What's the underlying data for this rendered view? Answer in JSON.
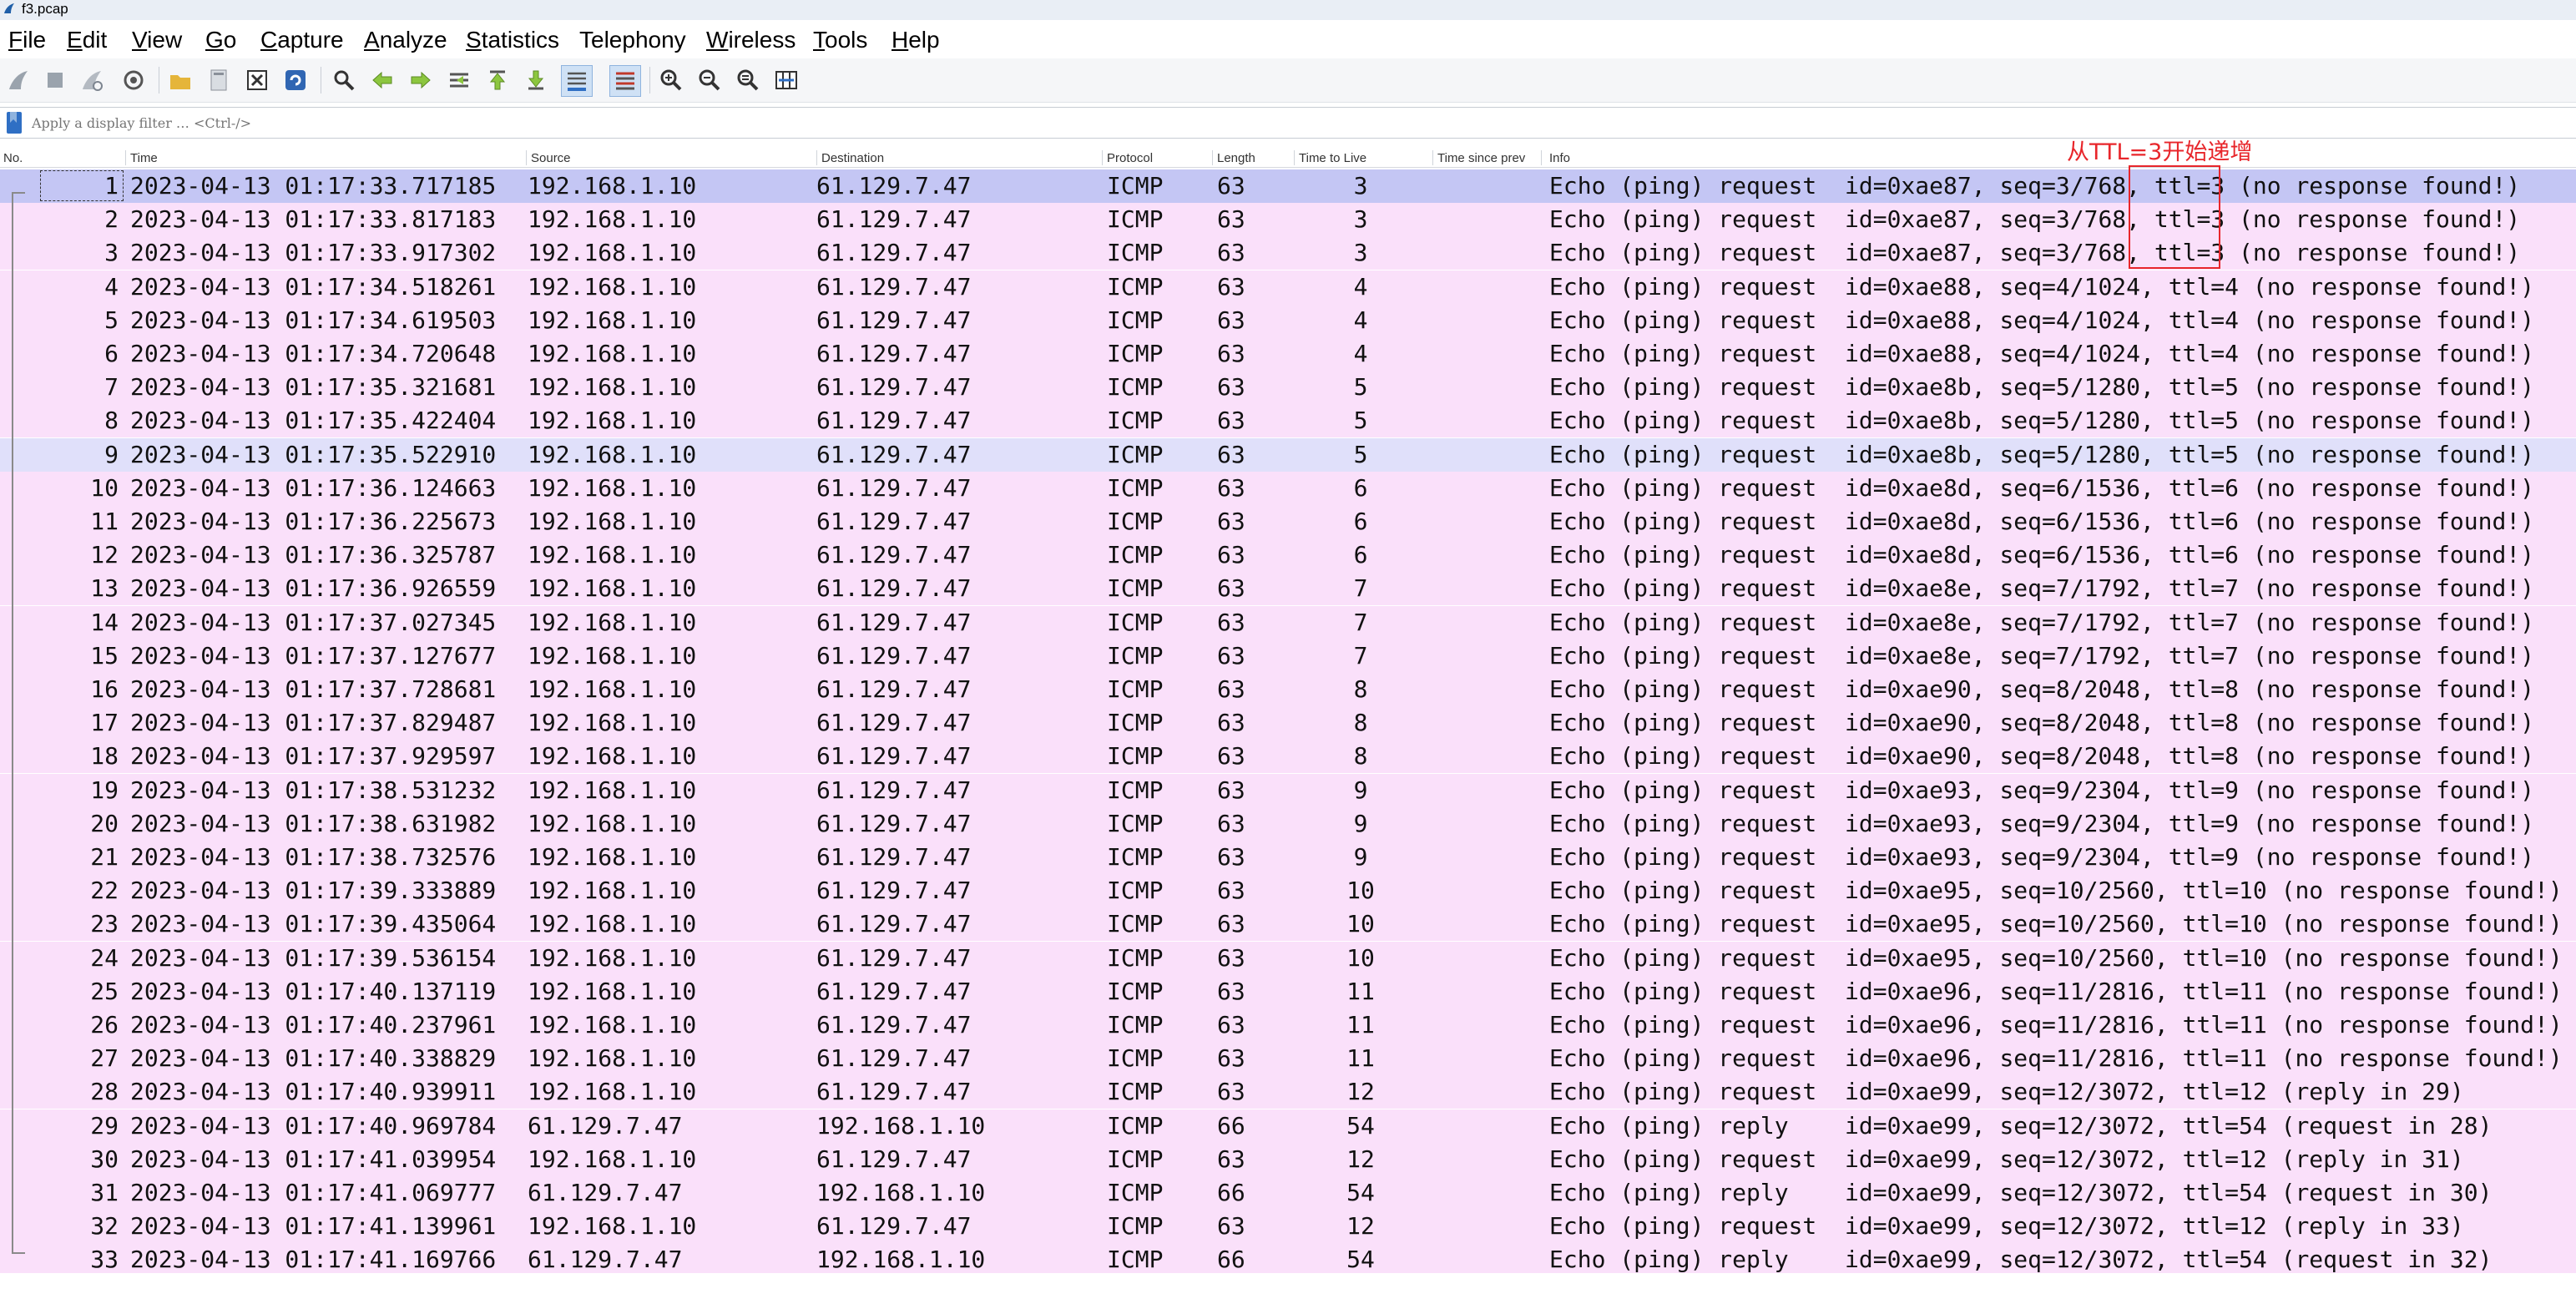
{
  "window": {
    "title": "f3.pcap"
  },
  "menu": [
    {
      "label": "File",
      "ul": "F",
      "rest": "ile"
    },
    {
      "label": "Edit",
      "ul": "E",
      "rest": "dit"
    },
    {
      "label": "View",
      "ul": "V",
      "rest": "iew"
    },
    {
      "label": "Go",
      "ul": "G",
      "rest": "o"
    },
    {
      "label": "Capture",
      "ul": "C",
      "rest": "apture"
    },
    {
      "label": "Analyze",
      "ul": "A",
      "rest": "nalyze"
    },
    {
      "label": "Statistics",
      "ul": "S",
      "rest": "tatistics"
    },
    {
      "label": "Telephony",
      "ul": "",
      "rest": "Telephony"
    },
    {
      "label": "Wireless",
      "ul": "W",
      "rest": "ireless"
    },
    {
      "label": "Tools",
      "ul": "T",
      "rest": "ools"
    },
    {
      "label": "Help",
      "ul": "H",
      "rest": "elp"
    }
  ],
  "filter": {
    "placeholder": "Apply a display filter … <Ctrl-/>"
  },
  "columns": {
    "no": "No.",
    "time": "Time",
    "source": "Source",
    "destination": "Destination",
    "protocol": "Protocol",
    "length": "Length",
    "ttl": "Time to Live",
    "since": "Time since prev",
    "info": "Info"
  },
  "annotation": {
    "text": "从TTL=3开始递增"
  },
  "colors": {
    "row": "#fae0fa",
    "selected": "#c4c6f4",
    "highlight": "#e0e0fa",
    "annotation": "#e8262b"
  },
  "rows": [
    {
      "no": "1",
      "time": "2023-04-13 01:17:33.717185",
      "src": "192.168.1.10",
      "dst": "61.129.7.47",
      "proto": "ICMP",
      "len": "63",
      "ttl": "3",
      "info": "Echo (ping) request  id=0xae87, seq=3/768, ttl=3 (no response found!)"
    },
    {
      "no": "2",
      "time": "2023-04-13 01:17:33.817183",
      "src": "192.168.1.10",
      "dst": "61.129.7.47",
      "proto": "ICMP",
      "len": "63",
      "ttl": "3",
      "info": "Echo (ping) request  id=0xae87, seq=3/768, ttl=3 (no response found!)"
    },
    {
      "no": "3",
      "time": "2023-04-13 01:17:33.917302",
      "src": "192.168.1.10",
      "dst": "61.129.7.47",
      "proto": "ICMP",
      "len": "63",
      "ttl": "3",
      "info": "Echo (ping) request  id=0xae87, seq=3/768, ttl=3 (no response found!)"
    },
    {
      "no": "4",
      "time": "2023-04-13 01:17:34.518261",
      "src": "192.168.1.10",
      "dst": "61.129.7.47",
      "proto": "ICMP",
      "len": "63",
      "ttl": "4",
      "info": "Echo (ping) request  id=0xae88, seq=4/1024, ttl=4 (no response found!)"
    },
    {
      "no": "5",
      "time": "2023-04-13 01:17:34.619503",
      "src": "192.168.1.10",
      "dst": "61.129.7.47",
      "proto": "ICMP",
      "len": "63",
      "ttl": "4",
      "info": "Echo (ping) request  id=0xae88, seq=4/1024, ttl=4 (no response found!)"
    },
    {
      "no": "6",
      "time": "2023-04-13 01:17:34.720648",
      "src": "192.168.1.10",
      "dst": "61.129.7.47",
      "proto": "ICMP",
      "len": "63",
      "ttl": "4",
      "info": "Echo (ping) request  id=0xae88, seq=4/1024, ttl=4 (no response found!)"
    },
    {
      "no": "7",
      "time": "2023-04-13 01:17:35.321681",
      "src": "192.168.1.10",
      "dst": "61.129.7.47",
      "proto": "ICMP",
      "len": "63",
      "ttl": "5",
      "info": "Echo (ping) request  id=0xae8b, seq=5/1280, ttl=5 (no response found!)"
    },
    {
      "no": "8",
      "time": "2023-04-13 01:17:35.422404",
      "src": "192.168.1.10",
      "dst": "61.129.7.47",
      "proto": "ICMP",
      "len": "63",
      "ttl": "5",
      "info": "Echo (ping) request  id=0xae8b, seq=5/1280, ttl=5 (no response found!)"
    },
    {
      "no": "9",
      "time": "2023-04-13 01:17:35.522910",
      "src": "192.168.1.10",
      "dst": "61.129.7.47",
      "proto": "ICMP",
      "len": "63",
      "ttl": "5",
      "info": "Echo (ping) request  id=0xae8b, seq=5/1280, ttl=5 (no response found!)"
    },
    {
      "no": "10",
      "time": "2023-04-13 01:17:36.124663",
      "src": "192.168.1.10",
      "dst": "61.129.7.47",
      "proto": "ICMP",
      "len": "63",
      "ttl": "6",
      "info": "Echo (ping) request  id=0xae8d, seq=6/1536, ttl=6 (no response found!)"
    },
    {
      "no": "11",
      "time": "2023-04-13 01:17:36.225673",
      "src": "192.168.1.10",
      "dst": "61.129.7.47",
      "proto": "ICMP",
      "len": "63",
      "ttl": "6",
      "info": "Echo (ping) request  id=0xae8d, seq=6/1536, ttl=6 (no response found!)"
    },
    {
      "no": "12",
      "time": "2023-04-13 01:17:36.325787",
      "src": "192.168.1.10",
      "dst": "61.129.7.47",
      "proto": "ICMP",
      "len": "63",
      "ttl": "6",
      "info": "Echo (ping) request  id=0xae8d, seq=6/1536, ttl=6 (no response found!)"
    },
    {
      "no": "13",
      "time": "2023-04-13 01:17:36.926559",
      "src": "192.168.1.10",
      "dst": "61.129.7.47",
      "proto": "ICMP",
      "len": "63",
      "ttl": "7",
      "info": "Echo (ping) request  id=0xae8e, seq=7/1792, ttl=7 (no response found!)"
    },
    {
      "no": "14",
      "time": "2023-04-13 01:17:37.027345",
      "src": "192.168.1.10",
      "dst": "61.129.7.47",
      "proto": "ICMP",
      "len": "63",
      "ttl": "7",
      "info": "Echo (ping) request  id=0xae8e, seq=7/1792, ttl=7 (no response found!)"
    },
    {
      "no": "15",
      "time": "2023-04-13 01:17:37.127677",
      "src": "192.168.1.10",
      "dst": "61.129.7.47",
      "proto": "ICMP",
      "len": "63",
      "ttl": "7",
      "info": "Echo (ping) request  id=0xae8e, seq=7/1792, ttl=7 (no response found!)"
    },
    {
      "no": "16",
      "time": "2023-04-13 01:17:37.728681",
      "src": "192.168.1.10",
      "dst": "61.129.7.47",
      "proto": "ICMP",
      "len": "63",
      "ttl": "8",
      "info": "Echo (ping) request  id=0xae90, seq=8/2048, ttl=8 (no response found!)"
    },
    {
      "no": "17",
      "time": "2023-04-13 01:17:37.829487",
      "src": "192.168.1.10",
      "dst": "61.129.7.47",
      "proto": "ICMP",
      "len": "63",
      "ttl": "8",
      "info": "Echo (ping) request  id=0xae90, seq=8/2048, ttl=8 (no response found!)"
    },
    {
      "no": "18",
      "time": "2023-04-13 01:17:37.929597",
      "src": "192.168.1.10",
      "dst": "61.129.7.47",
      "proto": "ICMP",
      "len": "63",
      "ttl": "8",
      "info": "Echo (ping) request  id=0xae90, seq=8/2048, ttl=8 (no response found!)"
    },
    {
      "no": "19",
      "time": "2023-04-13 01:17:38.531232",
      "src": "192.168.1.10",
      "dst": "61.129.7.47",
      "proto": "ICMP",
      "len": "63",
      "ttl": "9",
      "info": "Echo (ping) request  id=0xae93, seq=9/2304, ttl=9 (no response found!)"
    },
    {
      "no": "20",
      "time": "2023-04-13 01:17:38.631982",
      "src": "192.168.1.10",
      "dst": "61.129.7.47",
      "proto": "ICMP",
      "len": "63",
      "ttl": "9",
      "info": "Echo (ping) request  id=0xae93, seq=9/2304, ttl=9 (no response found!)"
    },
    {
      "no": "21",
      "time": "2023-04-13 01:17:38.732576",
      "src": "192.168.1.10",
      "dst": "61.129.7.47",
      "proto": "ICMP",
      "len": "63",
      "ttl": "9",
      "info": "Echo (ping) request  id=0xae93, seq=9/2304, ttl=9 (no response found!)"
    },
    {
      "no": "22",
      "time": "2023-04-13 01:17:39.333889",
      "src": "192.168.1.10",
      "dst": "61.129.7.47",
      "proto": "ICMP",
      "len": "63",
      "ttl": "10",
      "info": "Echo (ping) request  id=0xae95, seq=10/2560, ttl=10 (no response found!)"
    },
    {
      "no": "23",
      "time": "2023-04-13 01:17:39.435064",
      "src": "192.168.1.10",
      "dst": "61.129.7.47",
      "proto": "ICMP",
      "len": "63",
      "ttl": "10",
      "info": "Echo (ping) request  id=0xae95, seq=10/2560, ttl=10 (no response found!)"
    },
    {
      "no": "24",
      "time": "2023-04-13 01:17:39.536154",
      "src": "192.168.1.10",
      "dst": "61.129.7.47",
      "proto": "ICMP",
      "len": "63",
      "ttl": "10",
      "info": "Echo (ping) request  id=0xae95, seq=10/2560, ttl=10 (no response found!)"
    },
    {
      "no": "25",
      "time": "2023-04-13 01:17:40.137119",
      "src": "192.168.1.10",
      "dst": "61.129.7.47",
      "proto": "ICMP",
      "len": "63",
      "ttl": "11",
      "info": "Echo (ping) request  id=0xae96, seq=11/2816, ttl=11 (no response found!)"
    },
    {
      "no": "26",
      "time": "2023-04-13 01:17:40.237961",
      "src": "192.168.1.10",
      "dst": "61.129.7.47",
      "proto": "ICMP",
      "len": "63",
      "ttl": "11",
      "info": "Echo (ping) request  id=0xae96, seq=11/2816, ttl=11 (no response found!)"
    },
    {
      "no": "27",
      "time": "2023-04-13 01:17:40.338829",
      "src": "192.168.1.10",
      "dst": "61.129.7.47",
      "proto": "ICMP",
      "len": "63",
      "ttl": "11",
      "info": "Echo (ping) request  id=0xae96, seq=11/2816, ttl=11 (no response found!)"
    },
    {
      "no": "28",
      "time": "2023-04-13 01:17:40.939911",
      "src": "192.168.1.10",
      "dst": "61.129.7.47",
      "proto": "ICMP",
      "len": "63",
      "ttl": "12",
      "info": "Echo (ping) request  id=0xae99, seq=12/3072, ttl=12 (reply in 29)"
    },
    {
      "no": "29",
      "time": "2023-04-13 01:17:40.969784",
      "src": "61.129.7.47",
      "dst": "192.168.1.10",
      "proto": "ICMP",
      "len": "66",
      "ttl": "54",
      "info": "Echo (ping) reply    id=0xae99, seq=12/3072, ttl=54 (request in 28)"
    },
    {
      "no": "30",
      "time": "2023-04-13 01:17:41.039954",
      "src": "192.168.1.10",
      "dst": "61.129.7.47",
      "proto": "ICMP",
      "len": "63",
      "ttl": "12",
      "info": "Echo (ping) request  id=0xae99, seq=12/3072, ttl=12 (reply in 31)"
    },
    {
      "no": "31",
      "time": "2023-04-13 01:17:41.069777",
      "src": "61.129.7.47",
      "dst": "192.168.1.10",
      "proto": "ICMP",
      "len": "66",
      "ttl": "54",
      "info": "Echo (ping) reply    id=0xae99, seq=12/3072, ttl=54 (request in 30)"
    },
    {
      "no": "32",
      "time": "2023-04-13 01:17:41.139961",
      "src": "192.168.1.10",
      "dst": "61.129.7.47",
      "proto": "ICMP",
      "len": "63",
      "ttl": "12",
      "info": "Echo (ping) request  id=0xae99, seq=12/3072, ttl=12 (reply in 33)"
    },
    {
      "no": "33",
      "time": "2023-04-13 01:17:41.169766",
      "src": "61.129.7.47",
      "dst": "192.168.1.10",
      "proto": "ICMP",
      "len": "66",
      "ttl": "54",
      "info": "Echo (ping) reply    id=0xae99, seq=12/3072, ttl=54 (request in 32)"
    }
  ]
}
